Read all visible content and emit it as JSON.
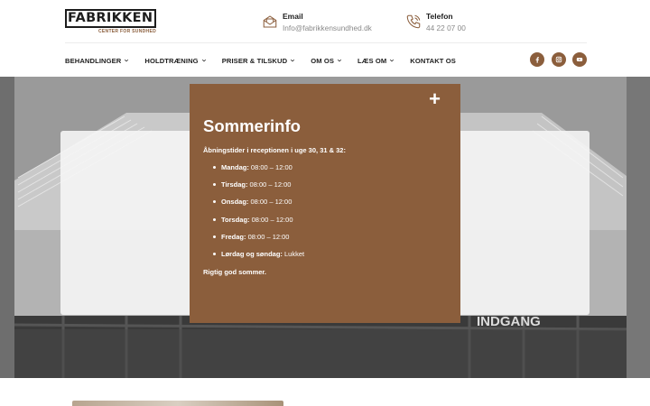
{
  "brand": {
    "name": "FABRIKKEN",
    "tagline": "CENTER FOR SUNDHED"
  },
  "contact": {
    "email_label": "Email",
    "email_value": "Info@fabrikkensundhed.dk",
    "phone_label": "Telefon",
    "phone_value": "44 22 07 00"
  },
  "nav": {
    "items": [
      {
        "label": "BEHANDLINGER",
        "has_dropdown": true
      },
      {
        "label": "HOLDTRÆNING",
        "has_dropdown": true
      },
      {
        "label": "PRISER & TILSKUD",
        "has_dropdown": true
      },
      {
        "label": "OM OS",
        "has_dropdown": true
      },
      {
        "label": "LÆS OM",
        "has_dropdown": true
      },
      {
        "label": "KONTAKT OS",
        "has_dropdown": false
      }
    ]
  },
  "social": [
    {
      "icon": "facebook-icon"
    },
    {
      "icon": "instagram-icon"
    },
    {
      "icon": "youtube-icon"
    }
  ],
  "popup": {
    "close_label": "+",
    "title": "Sommerinfo",
    "intro": "Åbningstider i receptionen i uge 30, 31 & 32:",
    "hours": [
      {
        "day": "Mandag:",
        "time": " 08:00 – 12:00"
      },
      {
        "day": "Tirsdag:",
        "time": " 08:00 – 12:00"
      },
      {
        "day": "Onsdag:",
        "time": " 08:00 – 12:00"
      },
      {
        "day": "Torsdag:",
        "time": " 08:00 – 12:00"
      },
      {
        "day": "Fredag:",
        "time": " 08:00 – 12:00"
      },
      {
        "day": "Lørdag og søndag:",
        "time": " Lukket"
      }
    ],
    "outro": "Rigtig god sommer."
  },
  "hero": {
    "sign_text": "INDGANG"
  },
  "colors": {
    "accent": "#8b5e3c",
    "text": "#1d1d1d",
    "muted": "#8a8a8a"
  }
}
